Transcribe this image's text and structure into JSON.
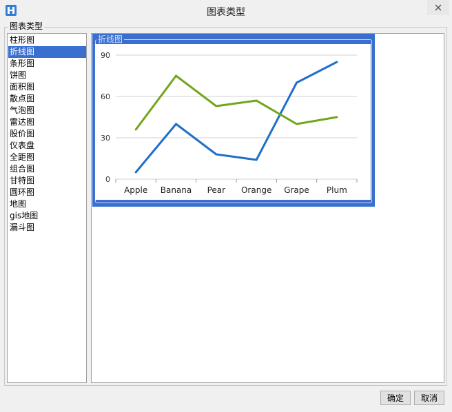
{
  "window": {
    "title": "图表类型"
  },
  "group_label": "图表类型",
  "chart_types": [
    {
      "label": "柱形图",
      "selected": false
    },
    {
      "label": "折线图",
      "selected": true
    },
    {
      "label": "条形图",
      "selected": false
    },
    {
      "label": "饼图",
      "selected": false
    },
    {
      "label": "面积图",
      "selected": false
    },
    {
      "label": "散点图",
      "selected": false
    },
    {
      "label": "气泡图",
      "selected": false
    },
    {
      "label": "雷达图",
      "selected": false
    },
    {
      "label": "股价图",
      "selected": false
    },
    {
      "label": "仪表盘",
      "selected": false
    },
    {
      "label": "全距图",
      "selected": false
    },
    {
      "label": "组合图",
      "selected": false
    },
    {
      "label": "甘特图",
      "selected": false
    },
    {
      "label": "圆环图",
      "selected": false
    },
    {
      "label": "地图",
      "selected": false
    },
    {
      "label": "gis地图",
      "selected": false
    },
    {
      "label": "漏斗图",
      "selected": false
    }
  ],
  "preview": {
    "title": "折线图"
  },
  "buttons": {
    "ok": "确定",
    "cancel": "取消"
  },
  "colors": {
    "selection": "#3a6fcf",
    "series1": "#1f6fc8",
    "series2": "#72a51a",
    "gridline": "#d0d0d0"
  },
  "chart_data": {
    "type": "line",
    "categories": [
      "Apple",
      "Banana",
      "Pear",
      "Orange",
      "Grape",
      "Plum"
    ],
    "yticks": [
      0,
      30,
      60,
      90
    ],
    "ylim": [
      0,
      90
    ],
    "grid": true,
    "series": [
      {
        "values": [
          5,
          40,
          18,
          14,
          70,
          85
        ],
        "color": "#1f6fc8"
      },
      {
        "values": [
          36,
          75,
          53,
          57,
          40,
          45
        ],
        "color": "#72a51a"
      }
    ]
  }
}
